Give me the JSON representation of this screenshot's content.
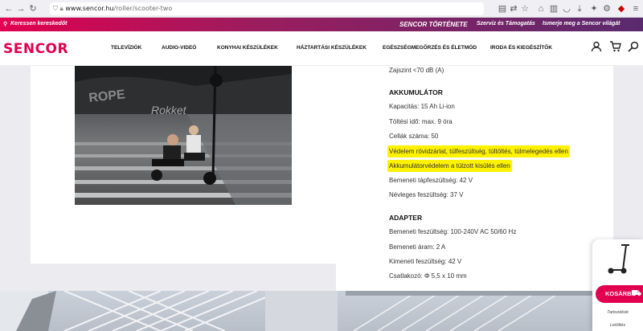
{
  "browser": {
    "url_host": "www.sencor.hu",
    "url_path": "/roller/scooter-two"
  },
  "topbar": {
    "dealer_finder": "Keressen kereskedőt",
    "story": "SENCOR TÖRTÉNETE",
    "service": "Szerviz és Támogatás",
    "world": "Ismerje meg a Sencor világát"
  },
  "nav": {
    "logo": "SENCOR",
    "items": [
      "TELEVÍZIÓK",
      "AUDIO-VIDEÓ",
      "KONYHAI KÉSZÜLÉKEK",
      "HÁZTARTÁSI KÉSZÜLÉKEK",
      "EGÉSZSÉGMEGŐRZÉS ÉS ÉLETMÓD",
      "IRODA ÉS KIEGÉSZÍTŐK"
    ]
  },
  "specs": {
    "noise": "Zajszint <70 dB (A)",
    "battery_heading": "AKKUMULÁTOR",
    "capacity": "Kapacitás: 15 Ah Li-ion",
    "charge_time": "Töltési idő: max. 9 óra",
    "cell_count": "Cellák száma: 50",
    "protection": "Védelem rövidzárlat, túlfeszültség, túltöltés, túlmelegedés ellen",
    "deep_discharge": "Akkumulátorvédelem a túlzott kisülés ellen",
    "input_voltage": "Bemeneti tápfeszültség: 42 V",
    "nominal_voltage": "Névleges feszültség: 37 V",
    "adapter_heading": "ADAPTER",
    "adapter_input": "Bemeneti feszültség: 100-240V AC 50/60 Hz",
    "adapter_current": "Bemeneti áram: 2 A",
    "adapter_output": "Kimeneti feszültség: 42 V",
    "connector": "Csatlakozó: Φ 5,5 x 10 mm"
  },
  "sidewidget": {
    "cart_button": "KOSÁRBA",
    "link1": "Tartozékok",
    "link2": "Letöltés"
  },
  "colors": {
    "brand": "#e2004f",
    "highlight": "#fff200"
  }
}
